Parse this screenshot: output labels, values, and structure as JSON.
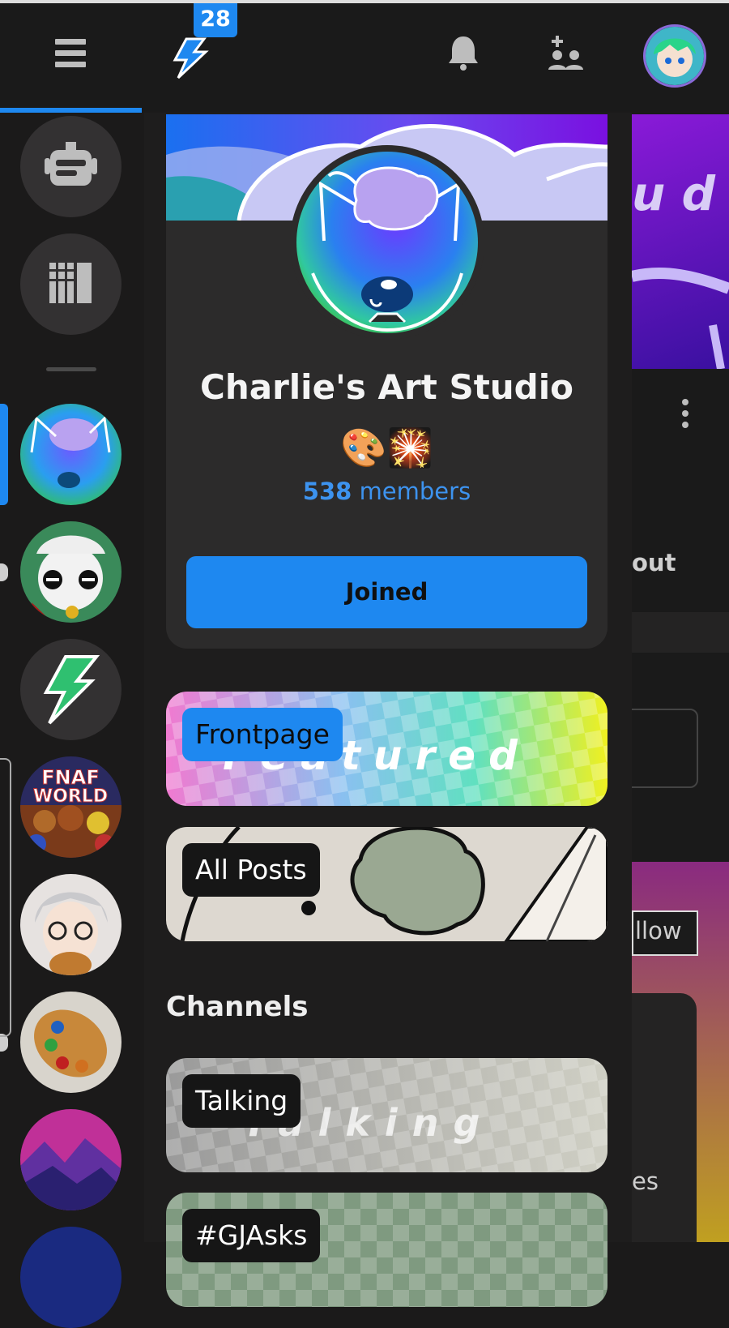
{
  "topbar": {
    "notification_count": "28",
    "icons": [
      "menu-icon",
      "bolt-icon",
      "bell-icon",
      "add-user-icon",
      "avatar"
    ]
  },
  "rail": {
    "top_buttons": [
      "chat-bot-icon",
      "catalog-icon"
    ]
  },
  "community": {
    "title": "Charlie's Art Studio",
    "emoji": "🎨🎇",
    "member_count": "538",
    "member_label": "members",
    "join_label": "Joined"
  },
  "pages": {
    "frontpage_label": "Frontpage",
    "frontpage_watermark": "Featured",
    "all_posts_label": "All Posts"
  },
  "channels": {
    "heading": "Channels",
    "items": [
      {
        "label": "Talking",
        "watermark": "Talking"
      },
      {
        "label": "#GJAsks"
      }
    ]
  },
  "background_peek": {
    "fragment1": "u d",
    "fragment2": "out",
    "fragment3": "llow",
    "fragment4": "es"
  },
  "colors": {
    "accent": "#1e88f0",
    "background": "#1b1a1a",
    "card": "#2c2b2b"
  }
}
